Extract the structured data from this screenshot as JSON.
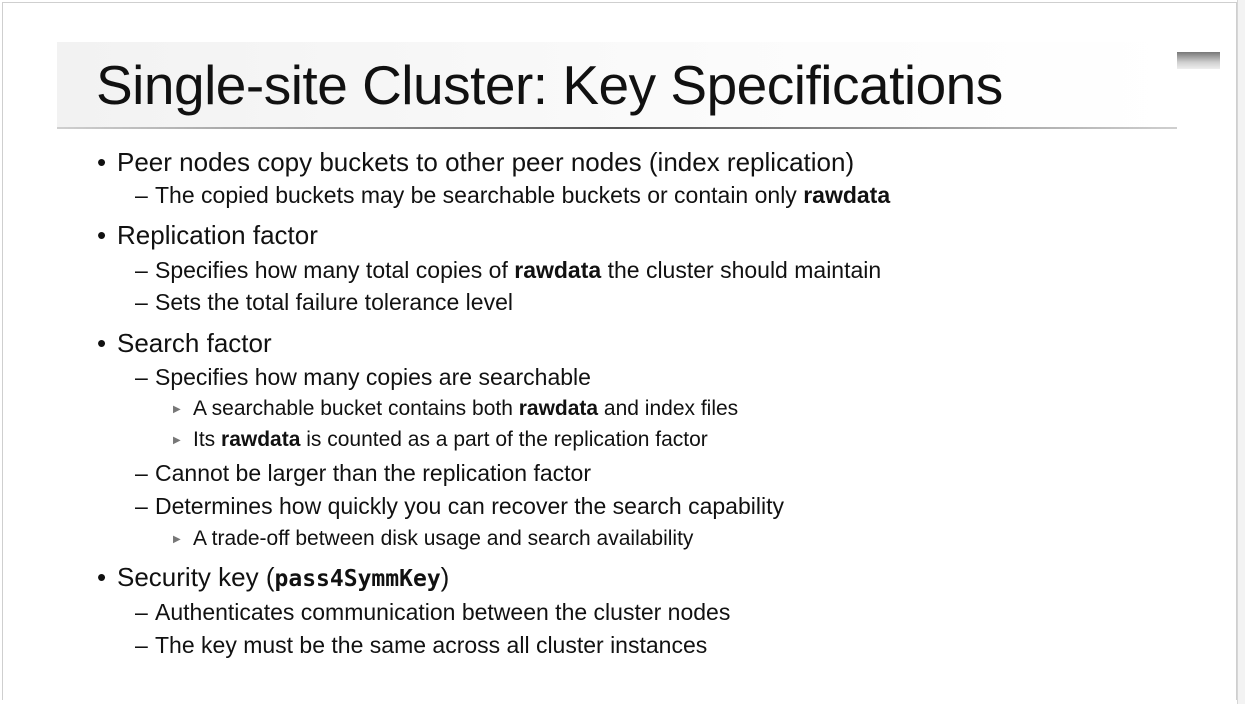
{
  "title": "Single-site Cluster: Key Specifications",
  "bullets": {
    "b1": {
      "text": "Peer nodes copy buckets to other peer nodes (index replication)"
    },
    "b1s1": {
      "a": "The copied buckets may be searchable buckets or contain only ",
      "b": "rawdata"
    },
    "b2": {
      "text": "Replication factor"
    },
    "b2s1": {
      "a": "Specifies how many total copies of ",
      "b": "rawdata",
      "c": " the cluster should maintain"
    },
    "b2s2": {
      "text": "Sets the total failure tolerance level"
    },
    "b3": {
      "text": "Search factor"
    },
    "b3s1": {
      "text": "Specifies how many copies are searchable"
    },
    "b3s1a": {
      "a": "A searchable bucket contains both ",
      "b": "rawdata",
      "c": " and index files"
    },
    "b3s1b": {
      "a": "Its ",
      "b": "rawdata",
      "c": " is counted as a part of the replication factor"
    },
    "b3s2": {
      "text": "Cannot be larger than the replication factor"
    },
    "b3s3": {
      "text": "Determines how quickly you can recover the search capability"
    },
    "b3s3a": {
      "text": "A trade-off between disk usage and search availability"
    },
    "b4": {
      "a": "Security key (",
      "code": "pass4SymmKey",
      "c": ")"
    },
    "b4s1": {
      "text": "Authenticates communication between the cluster nodes"
    },
    "b4s2": {
      "text": "The key must be the same across all cluster instances"
    }
  },
  "markers": {
    "level1": "•",
    "level2": "–",
    "level3": "▶"
  }
}
